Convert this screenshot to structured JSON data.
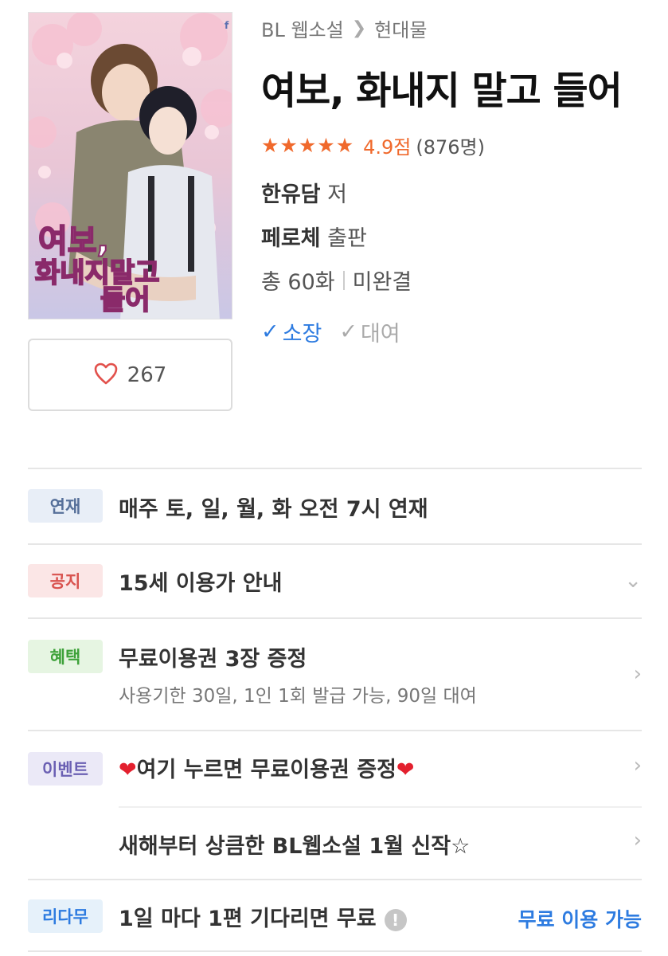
{
  "breadcrumb": {
    "category": "BL 웹소설",
    "subcategory": "현대물"
  },
  "book": {
    "title": "여보, 화내지 말고 들어",
    "cover_title_line1": "여보,",
    "cover_title_line2": "화내지말고",
    "cover_title_line3": "들어",
    "rating_score": "4.9점",
    "rating_count": "(876명)",
    "star_count": 5,
    "author_name": "한유담",
    "author_suffix": "저",
    "publisher_name": "페로체",
    "publisher_suffix": "출판",
    "episodes": "총 60화",
    "status": "미완결"
  },
  "ownership": {
    "own_label": "소장",
    "rent_label": "대여"
  },
  "like": {
    "count": "267"
  },
  "info_rows": [
    {
      "badge": "연재",
      "main": "매주 토, 일, 월, 화 오전 7시 연재"
    },
    {
      "badge": "공지",
      "main": "15세 이용가 안내"
    },
    {
      "badge": "혜택",
      "main": "무료이용권 3장 증정",
      "sub": "사용기한 30일, 1인 1회 발급 가능, 90일 대여"
    },
    {
      "badge": "이벤트",
      "main_text": "여기 누르면 무료이용권 증정",
      "heart": "❤",
      "main2": "새해부터 상큼한 BL웹소설 1월 신작☆"
    },
    {
      "badge": "리다무",
      "main": "1일 마다 1편 기다리면 무료",
      "info_icon": "!",
      "side": "무료 이용 가능"
    }
  ],
  "colors": {
    "accent_orange": "#f0692c",
    "accent_blue": "#2d7be0"
  }
}
